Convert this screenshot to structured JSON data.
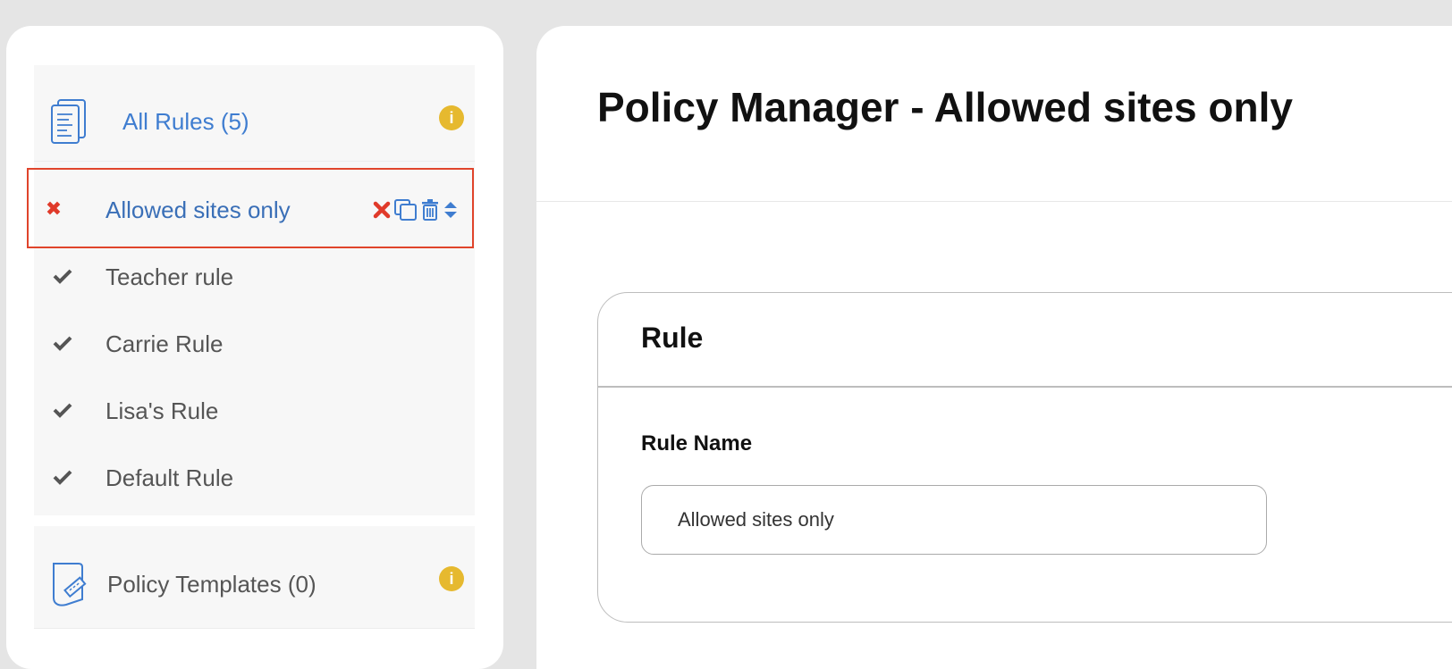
{
  "sidebar": {
    "all_rules_label": "All Rules (5)",
    "rules": [
      {
        "label": "Allowed sites only",
        "state": "disabled",
        "state_icon": "x-icon",
        "selected": true
      },
      {
        "label": "Teacher rule",
        "state": "enabled",
        "state_icon": "check-icon",
        "selected": false
      },
      {
        "label": "Carrie Rule",
        "state": "enabled",
        "state_icon": "check-icon",
        "selected": false
      },
      {
        "label": "Lisa's Rule",
        "state": "enabled",
        "state_icon": "check-icon",
        "selected": false
      },
      {
        "label": "Default Rule",
        "state": "enabled",
        "state_icon": "check-icon",
        "selected": false
      }
    ],
    "selected_actions": [
      "disable-icon",
      "copy-icon",
      "trash-icon",
      "sort-icon"
    ],
    "templates_label": "Policy Templates (0)",
    "info_glyph": "i"
  },
  "main": {
    "title": "Policy Manager - Allowed sites only",
    "rule_card": {
      "title": "Rule",
      "rule_name_label": "Rule Name",
      "rule_name_value": "Allowed sites only"
    }
  },
  "colors": {
    "accent_blue": "#3f7dd0",
    "selected_border": "#e0442b",
    "info_badge": "#e6b92f",
    "check_gray": "#555555",
    "x_red": "#e03a2a"
  }
}
